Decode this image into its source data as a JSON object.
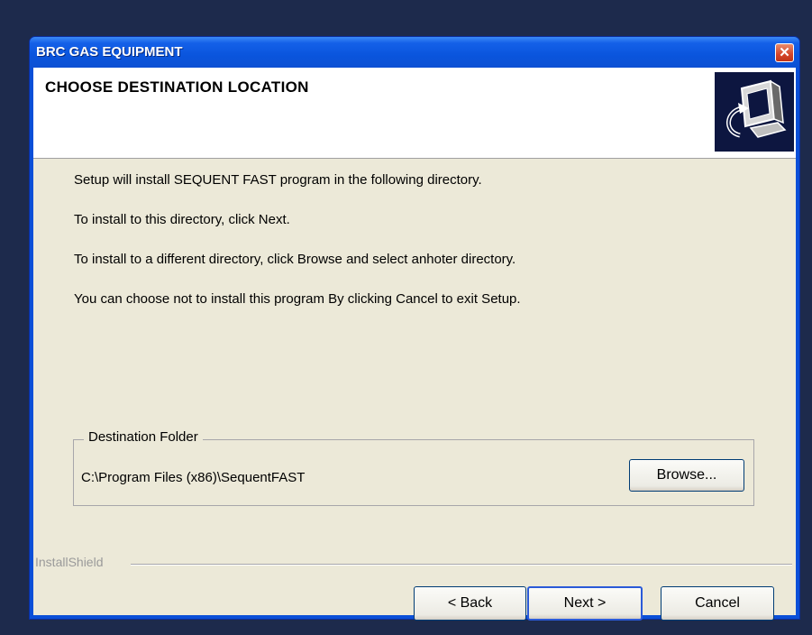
{
  "window": {
    "title": "BRC GAS EQUIPMENT",
    "close_glyph": "✕"
  },
  "header": {
    "title": "CHOOSE DESTINATION LOCATION",
    "icon": "computer-setup-icon"
  },
  "body": {
    "lines": [
      "Setup will install SEQUENT FAST program in the following directory.",
      "To install to this directory, click Next.",
      "To install to a different directory, click Browse and select anhoter directory.",
      "You can choose not to install this program By clicking Cancel to exit Setup."
    ]
  },
  "destination": {
    "group_label": "Destination Folder",
    "path": "C:\\Program Files (x86)\\SequentFAST",
    "browse_label": "Browse..."
  },
  "footer": {
    "brand": "InstallShield",
    "back_label": "< Back",
    "next_label": "Next >",
    "cancel_label": "Cancel"
  },
  "colors": {
    "titlebar": "#0a55dd",
    "dialog_bg": "#ece9d8",
    "header_bg": "#ffffff",
    "icon_bg": "#0d1640"
  }
}
